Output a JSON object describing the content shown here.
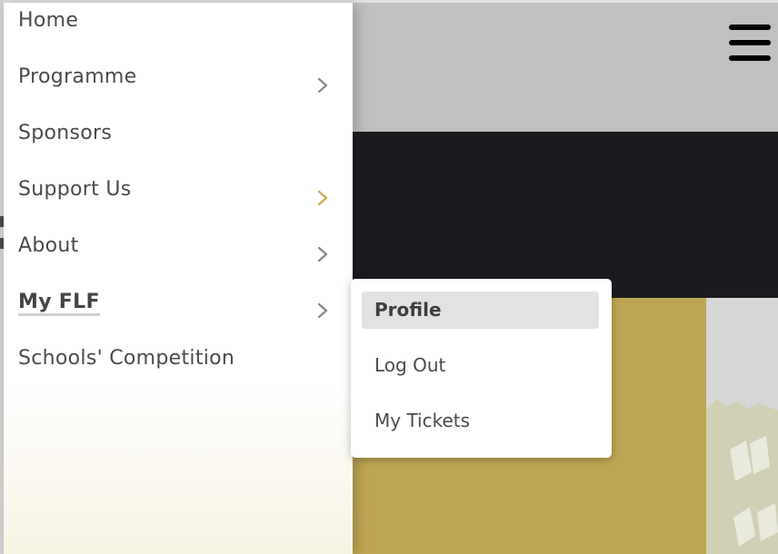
{
  "nav": {
    "items": [
      {
        "label": "Home",
        "has_submenu": false
      },
      {
        "label": "Programme",
        "has_submenu": true
      },
      {
        "label": "Sponsors",
        "has_submenu": false
      },
      {
        "label": "Support Us",
        "has_submenu": true
      },
      {
        "label": "About",
        "has_submenu": true
      },
      {
        "label": "My FLF",
        "has_submenu": true,
        "active": true
      },
      {
        "label": "Schools' Competition",
        "has_submenu": false
      }
    ]
  },
  "submenu": {
    "items": [
      {
        "label": "Profile",
        "highlighted": true
      },
      {
        "label": "Log Out",
        "highlighted": false
      },
      {
        "label": "My Tickets",
        "highlighted": false
      }
    ]
  },
  "header": {
    "menu_icon": "hamburger-menu-icon"
  },
  "colors": {
    "header_bg": "#c0c0c0",
    "hero_bg": "#1b1c1f",
    "gold_panel": "#bfa553",
    "grey_panel": "#d7d7d7",
    "chevron_default": "#8a8a8a",
    "chevron_accent": "#cfa85a",
    "text": "#4a4a4a",
    "highlight_bg": "#e2e2e2"
  }
}
